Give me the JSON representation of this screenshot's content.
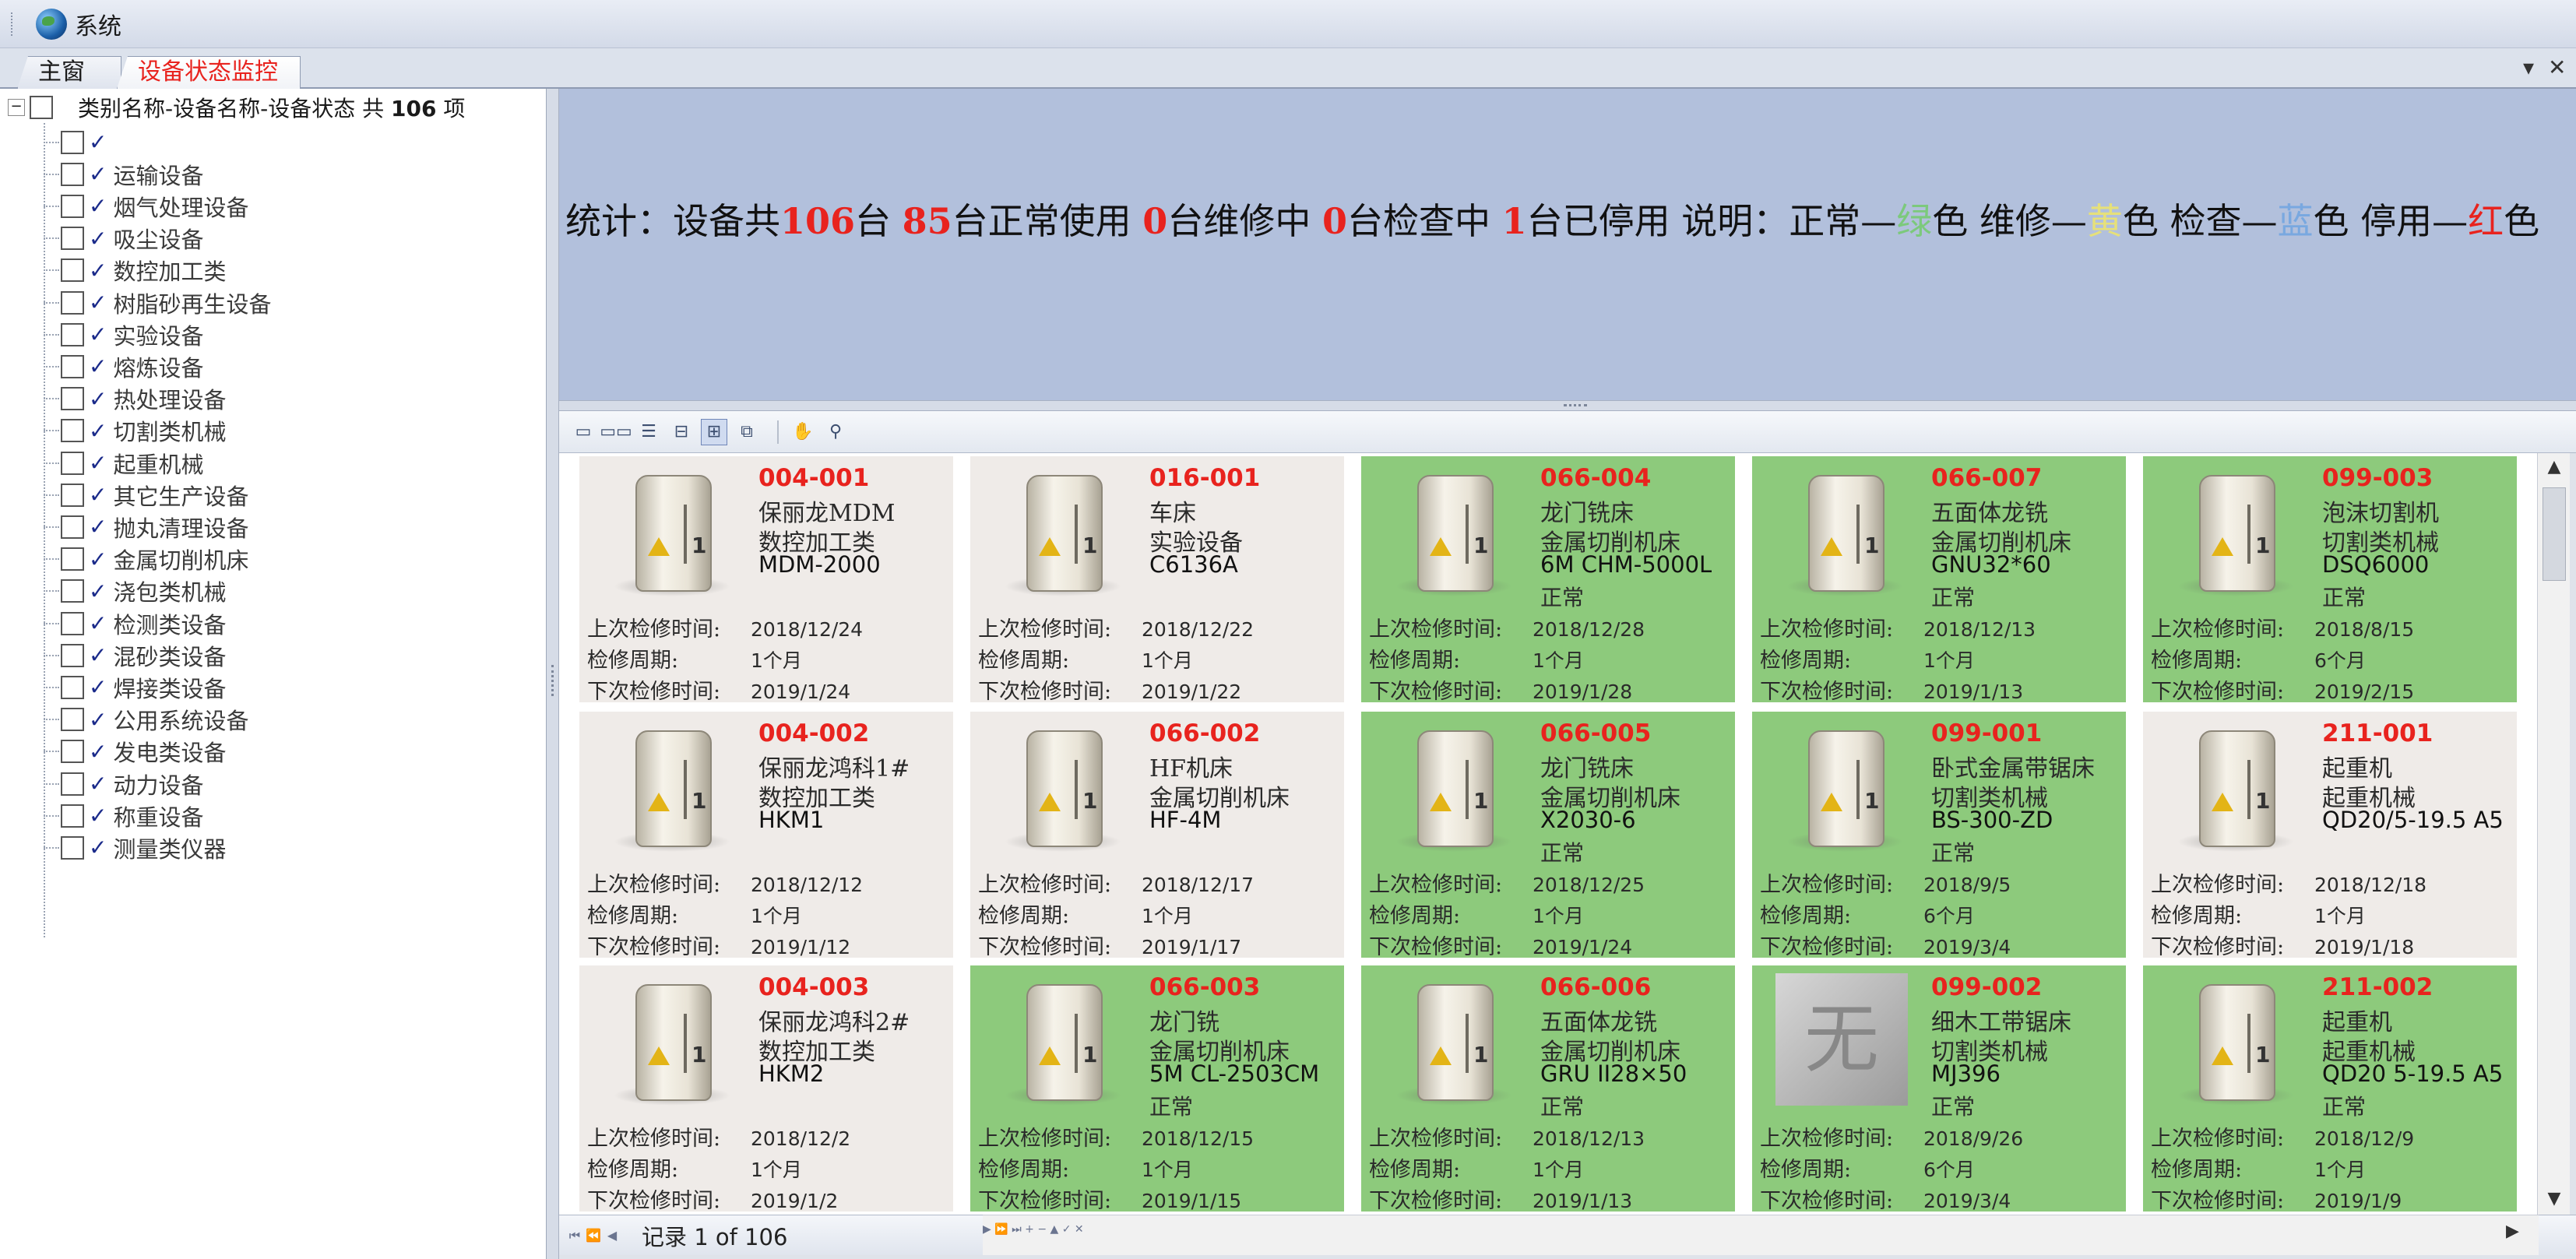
{
  "menubar": {
    "system_label": "系统"
  },
  "tabs": [
    {
      "label": "主窗口"
    },
    {
      "label": "设备状态监控"
    }
  ],
  "tab_controls": {
    "dropdown": "▾",
    "close": "✕"
  },
  "tree": {
    "root_prefix": "类别名称-设备名称-设备状态 共 ",
    "root_count": "106",
    "root_suffix": " 项",
    "items": [
      "",
      "运输设备",
      "烟气处理设备",
      "吸尘设备",
      "数控加工类",
      "树脂砂再生设备",
      "实验设备",
      "熔炼设备",
      "热处理设备",
      "切割类机械",
      "起重机械",
      "其它生产设备",
      "抛丸清理设备",
      "金属切削机床",
      "浇包类机械",
      "检测类设备",
      "混砂类设备",
      "焊接类设备",
      "公用系统设备",
      "发电类设备",
      "动力设备",
      "称重设备",
      "测量类仪器"
    ]
  },
  "stats": {
    "p1": "统计：设备共",
    "total": "106",
    "p2": "台 ",
    "normal": "85",
    "p3": "台正常使用 ",
    "repair": "0",
    "p4": "台维修中 ",
    "check": "0",
    "p5": "台检查中 ",
    "stopped": "1",
    "p6": "台已停用 说明：正常—",
    "green_word": "绿",
    "p7": "色 维修—",
    "yellow_word": "黄",
    "p8": "色 检查—",
    "blue_word": "蓝",
    "p9": "色 停用—",
    "red_word": "红",
    "p10": "色"
  },
  "colors": {
    "normal_card": "#8dca7c",
    "default_card": "#efebe8",
    "code_red": "#e8231e",
    "stats_bg": "#b2c0dc"
  },
  "labels": {
    "last_check": "上次检修时间:",
    "period": "检修周期:",
    "next_check": "下次检修时间:"
  },
  "cards": [
    {
      "code": "004-001",
      "name": "保丽龙MDM",
      "cat": "数控加工类",
      "model": "MDM-2000",
      "status": "",
      "last": "2018/12/24",
      "period": "1个月",
      "next": "2019/1/24",
      "green": false,
      "img": "fridge"
    },
    {
      "code": "016-001",
      "name": "车床",
      "cat": "实验设备",
      "model": "C6136A",
      "status": "",
      "last": "2018/12/22",
      "period": "1个月",
      "next": "2019/1/22",
      "green": false,
      "img": "fridge"
    },
    {
      "code": "066-004",
      "name": "龙门铣床",
      "cat": "金属切削机床",
      "model": "6M CHM-5000L",
      "status": "正常",
      "last": "2018/12/28",
      "period": "1个月",
      "next": "2019/1/28",
      "green": true,
      "img": "fridge"
    },
    {
      "code": "066-007",
      "name": "五面体龙铣",
      "cat": "金属切削机床",
      "model": "GNU32*60",
      "status": "正常",
      "last": "2018/12/13",
      "period": "1个月",
      "next": "2019/1/13",
      "green": true,
      "img": "fridge"
    },
    {
      "code": "099-003",
      "name": "泡沫切割机",
      "cat": "切割类机械",
      "model": "DSQ6000",
      "status": "正常",
      "last": "2018/8/15",
      "period": "6个月",
      "next": "2019/2/15",
      "green": true,
      "img": "fridge"
    },
    {
      "code": "004-002",
      "name": "保丽龙鸿科1#",
      "cat": "数控加工类",
      "model": "HKM1",
      "status": "",
      "last": "2018/12/12",
      "period": "1个月",
      "next": "2019/1/12",
      "green": false,
      "img": "fridge"
    },
    {
      "code": "066-002",
      "name": "HF机床",
      "cat": "金属切削机床",
      "model": "HF-4M",
      "status": "",
      "last": "2018/12/17",
      "period": "1个月",
      "next": "2019/1/17",
      "green": false,
      "img": "fridge"
    },
    {
      "code": "066-005",
      "name": "龙门铣床",
      "cat": "金属切削机床",
      "model": "X2030-6",
      "status": "正常",
      "last": "2018/12/25",
      "period": "1个月",
      "next": "2019/1/24",
      "green": true,
      "img": "fridge"
    },
    {
      "code": "099-001",
      "name": "卧式金属带锯床",
      "cat": "切割类机械",
      "model": "BS-300-ZD",
      "status": "正常",
      "last": "2018/9/5",
      "period": "6个月",
      "next": "2019/3/4",
      "green": true,
      "img": "fridge"
    },
    {
      "code": "211-001",
      "name": "起重机",
      "cat": "起重机械",
      "model": "QD20/5-19.5 A5",
      "status": "",
      "last": "2018/12/18",
      "period": "1个月",
      "next": "2019/1/18",
      "green": false,
      "img": "fridge"
    },
    {
      "code": "004-003",
      "name": "保丽龙鸿科2#",
      "cat": "数控加工类",
      "model": "HKM2",
      "status": "",
      "last": "2018/12/2",
      "period": "1个月",
      "next": "2019/1/2",
      "green": false,
      "img": "fridge"
    },
    {
      "code": "066-003",
      "name": "龙门铣",
      "cat": "金属切削机床",
      "model": "5M CL-2503CM",
      "status": "正常",
      "last": "2018/12/15",
      "period": "1个月",
      "next": "2019/1/15",
      "green": true,
      "img": "fridge"
    },
    {
      "code": "066-006",
      "name": "五面体龙铣",
      "cat": "金属切削机床",
      "model": "GRU II28×50",
      "status": "正常",
      "last": "2018/12/13",
      "period": "1个月",
      "next": "2019/1/13",
      "green": true,
      "img": "fridge"
    },
    {
      "code": "099-002",
      "name": "细木工带锯床",
      "cat": "切割类机械",
      "model": "MJ396",
      "status": "正常",
      "last": "2018/9/26",
      "period": "6个月",
      "next": "2019/3/4",
      "green": true,
      "img": "none",
      "img_text": "无"
    },
    {
      "code": "211-002",
      "name": "起重机",
      "cat": "起重机械",
      "model": "QD20 5-19.5 A5",
      "status": "正常",
      "last": "2018/12/9",
      "period": "1个月",
      "next": "2019/1/9",
      "green": true,
      "img": "fridge"
    }
  ],
  "navigator": {
    "record_label": "记录 ",
    "record_value": "1 of 106"
  }
}
